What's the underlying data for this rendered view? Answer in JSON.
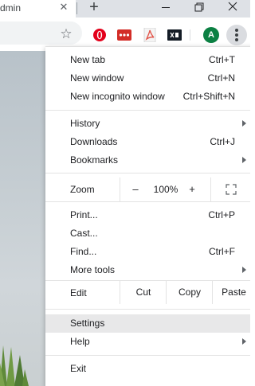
{
  "tab": {
    "title": "dmin",
    "close_glyph": "✕"
  },
  "tabstrip": {
    "new_tab_glyph": "+",
    "restore_glyph": "❐",
    "close_glyph": "✕"
  },
  "toolbar": {
    "star_glyph": "☆",
    "avatar_letter": "A",
    "avatar_color": "#0b8043",
    "extensions": [
      "opera-icon",
      "lastpass-icon",
      "pdf-icon",
      "dark-reader-icon"
    ]
  },
  "menu": {
    "group1": [
      {
        "label": "New tab",
        "shortcut": "Ctrl+T"
      },
      {
        "label": "New window",
        "shortcut": "Ctrl+N"
      },
      {
        "label": "New incognito window",
        "shortcut": "Ctrl+Shift+N"
      }
    ],
    "group2": [
      {
        "label": "History",
        "shortcut": ""
      },
      {
        "label": "Downloads",
        "shortcut": "Ctrl+J"
      },
      {
        "label": "Bookmarks",
        "shortcut": ""
      }
    ],
    "zoom": {
      "label": "Zoom",
      "minus": "–",
      "value": "100%",
      "plus": "+"
    },
    "group3": [
      {
        "label": "Print...",
        "shortcut": "Ctrl+P"
      },
      {
        "label": "Cast...",
        "shortcut": ""
      },
      {
        "label": "Find...",
        "shortcut": "Ctrl+F"
      },
      {
        "label": "More tools",
        "shortcut": ""
      }
    ],
    "edit": {
      "label": "Edit",
      "cut": "Cut",
      "copy": "Copy",
      "paste": "Paste"
    },
    "group4": [
      {
        "label": "Settings"
      },
      {
        "label": "Help"
      }
    ],
    "group5": [
      {
        "label": "Exit"
      }
    ]
  }
}
